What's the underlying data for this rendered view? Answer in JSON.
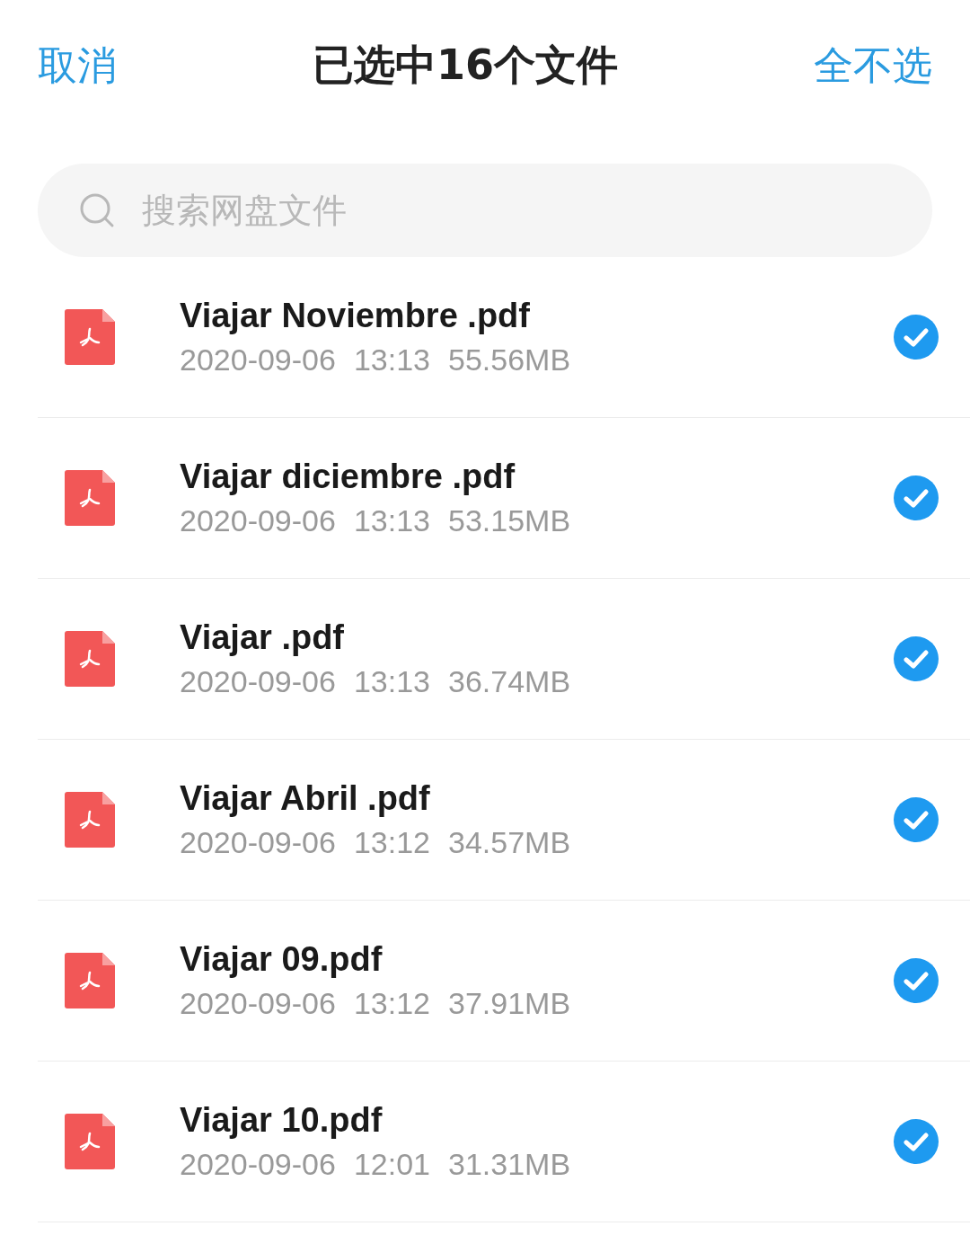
{
  "header": {
    "cancel": "取消",
    "title": "已选中16个文件",
    "deselect_all": "全不选"
  },
  "search": {
    "placeholder": "搜索网盘文件"
  },
  "files": [
    {
      "name": "Viajar Noviembre .pdf",
      "date": "2020-09-06",
      "time": "13:13",
      "size": "55.56MB",
      "checked": true
    },
    {
      "name": "Viajar diciembre .pdf",
      "date": "2020-09-06",
      "time": "13:13",
      "size": "53.15MB",
      "checked": true
    },
    {
      "name": "Viajar .pdf",
      "date": "2020-09-06",
      "time": "13:13",
      "size": "36.74MB",
      "checked": true
    },
    {
      "name": "Viajar Abril .pdf",
      "date": "2020-09-06",
      "time": "13:12",
      "size": "34.57MB",
      "checked": true
    },
    {
      "name": "Viajar 09.pdf",
      "date": "2020-09-06",
      "time": "13:12",
      "size": "37.91MB",
      "checked": true
    },
    {
      "name": "Viajar 10.pdf",
      "date": "2020-09-06",
      "time": "12:01",
      "size": "31.31MB",
      "checked": true
    }
  ]
}
